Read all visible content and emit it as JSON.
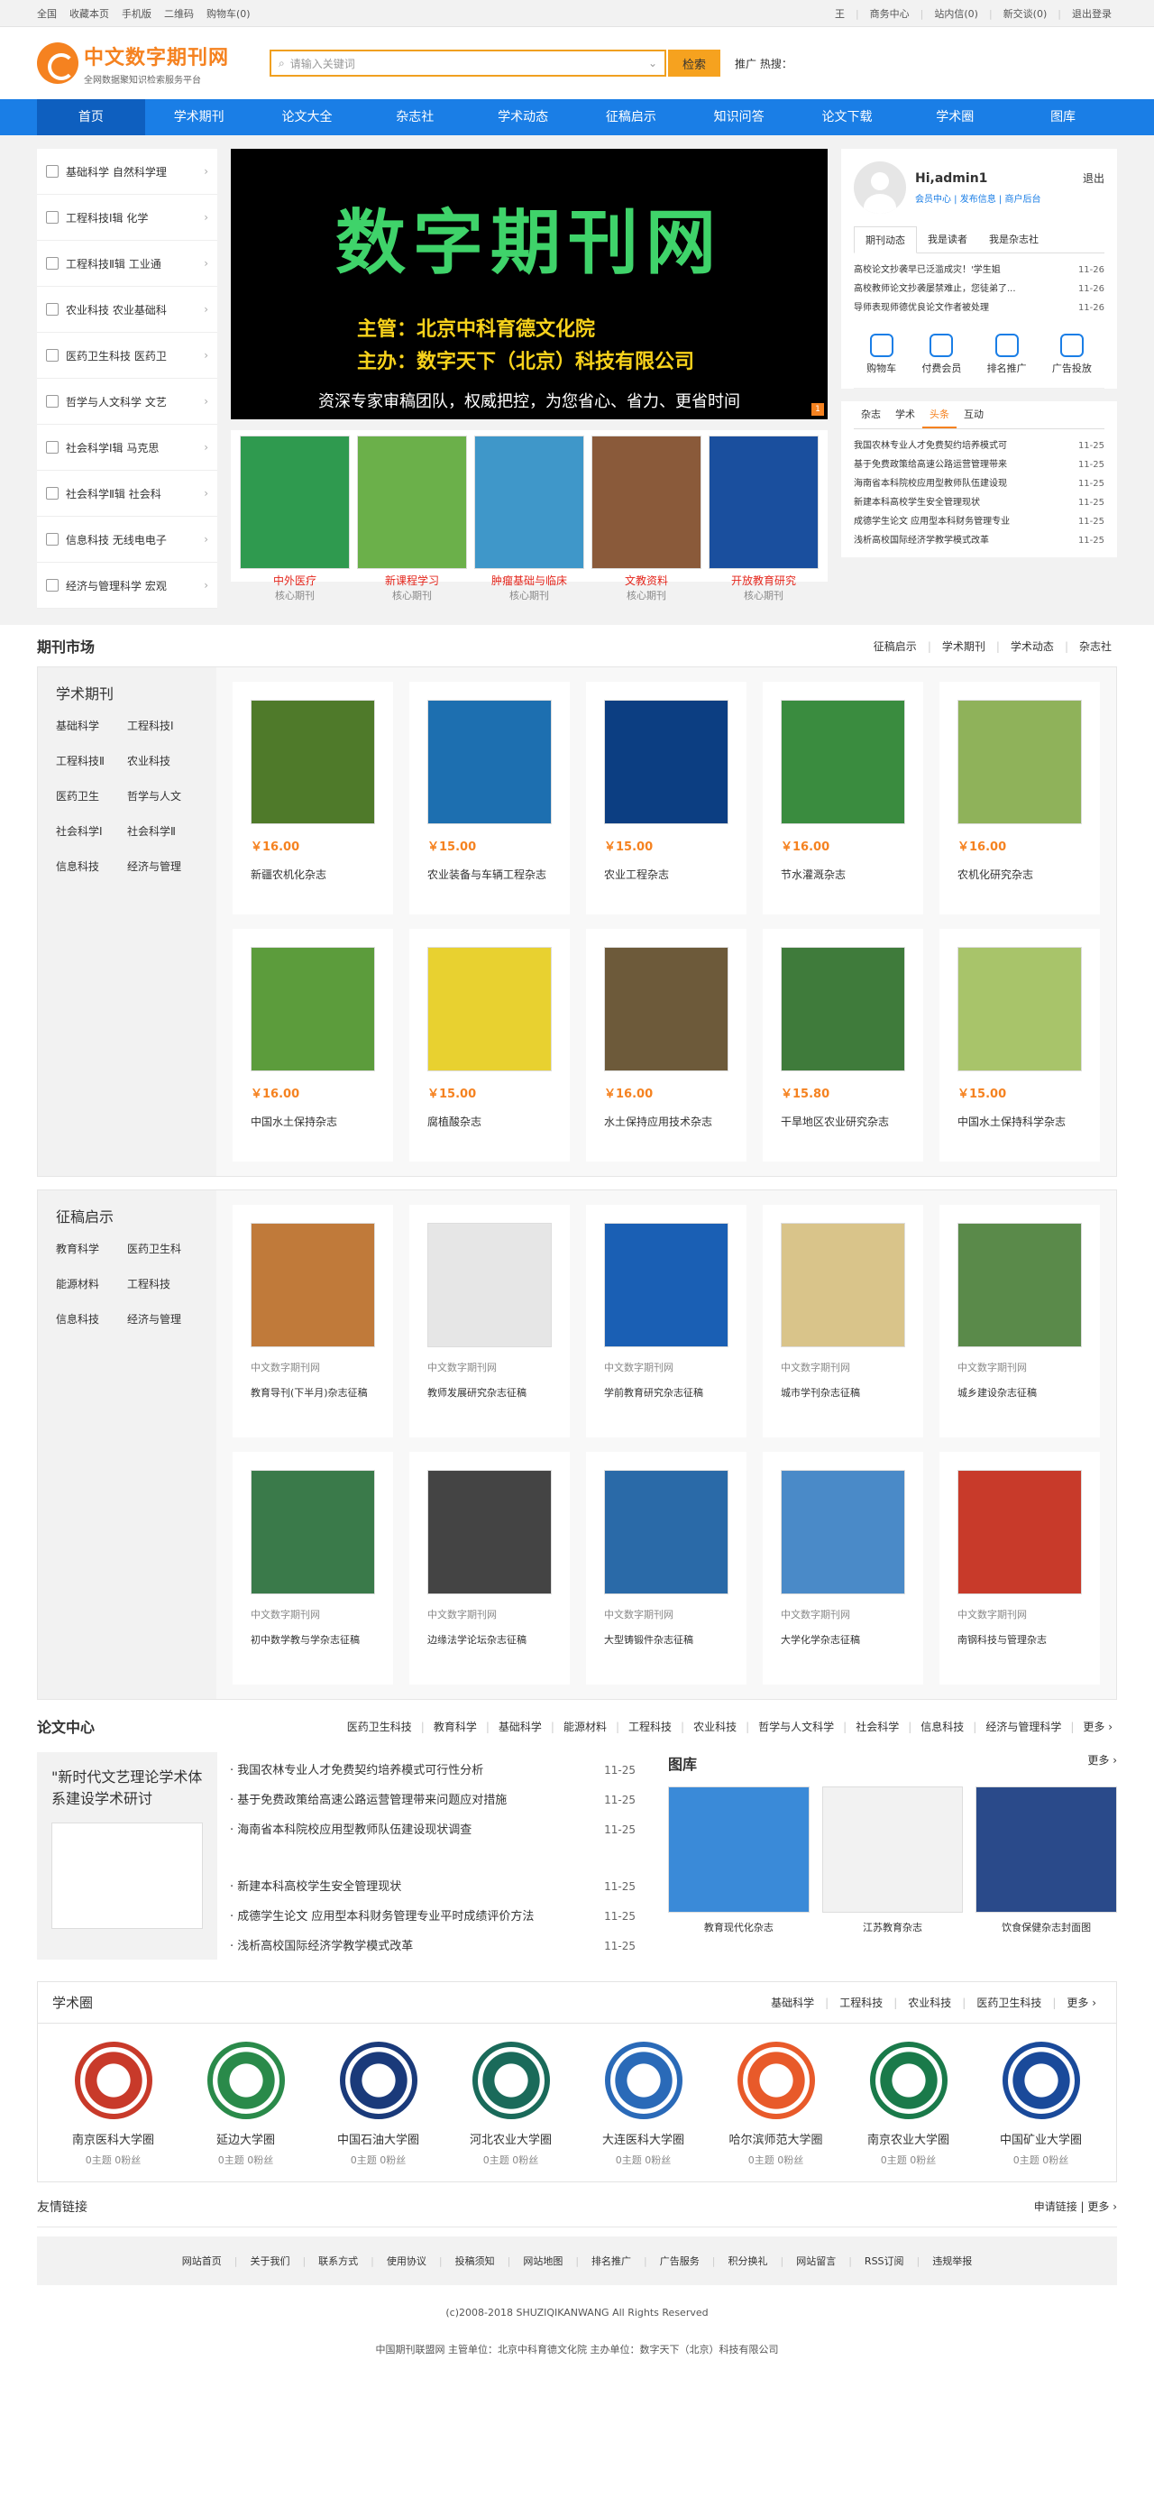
{
  "topbar": {
    "left": [
      "全国",
      "收藏本页",
      "手机版",
      "二维码",
      "购物车(0)"
    ],
    "right": [
      "王",
      "商务中心",
      "站内信(0)",
      "新交谈(0)",
      "退出登录"
    ]
  },
  "logo": {
    "title": "中文数字期刊网",
    "subtitle": "全网数据聚知识检索服务平台"
  },
  "search": {
    "placeholder": "请输入关键词",
    "button": "检索",
    "hot": "推广 热搜："
  },
  "nav": [
    "首页",
    "学术期刊",
    "论文大全",
    "杂志社",
    "学术动态",
    "征稿启示",
    "知识问答",
    "论文下载",
    "学术圈",
    "图库"
  ],
  "categories": [
    "基础科学 自然科学理",
    "工程科技Ⅰ辑 化学",
    "工程科技Ⅱ辑 工业通",
    "农业科技 农业基础科",
    "医药卫生科技 医药卫",
    "哲学与人文科学 文艺",
    "社会科学Ⅰ辑 马克思",
    "社会科学Ⅱ辑 社会科",
    "信息科技 无线电电子",
    "经济与管理科学 宏观"
  ],
  "slide": {
    "title": "数字期刊网",
    "line1": "主管：北京中科育德文化院",
    "line2": "主办：数字天下（北京）科技有限公司",
    "line3": "资深专家审稿团队，权威把控，为您省心、省力、更省时间",
    "page": "1"
  },
  "mags": [
    {
      "name": "中外医疗",
      "sub": "核心期刊",
      "color": "#2f9a4f"
    },
    {
      "name": "新课程学习",
      "sub": "核心期刊",
      "color": "#6bb04a"
    },
    {
      "name": "肿瘤基础与临床",
      "sub": "核心期刊",
      "color": "#3f97c9"
    },
    {
      "name": "文教资料",
      "sub": "核心期刊",
      "color": "#8a5a3a"
    },
    {
      "name": "开放教育研究",
      "sub": "核心期刊",
      "color": "#1a4f9e"
    }
  ],
  "user": {
    "name": "Hi,admin1",
    "links": "会员中心 | 发布信息 | 商户后台",
    "logout": "退出"
  },
  "userTabs": [
    "期刊动态",
    "我是读者",
    "我是杂志社"
  ],
  "userNews": [
    {
      "t": "高校论文抄袭早已泛滥成灾！'学生姐",
      "d": "11-26"
    },
    {
      "t": "高校教师论文抄袭屡禁难止，您徒弟了...",
      "d": "11-26"
    },
    {
      "t": "导师表现师德优良论文作者被处理",
      "d": "11-26"
    }
  ],
  "icons": [
    "购物车",
    "付费会员",
    "排名推广",
    "广告投放"
  ],
  "news2Tabs": [
    "杂志",
    "学术",
    "头条",
    "互动"
  ],
  "news2": [
    {
      "t": "我国农林专业人才免费契约培养模式可",
      "d": "11-25"
    },
    {
      "t": "基于免费政策给高速公路运营管理带来",
      "d": "11-25"
    },
    {
      "t": "海南省本科院校应用型教师队伍建设现",
      "d": "11-25"
    },
    {
      "t": "新建本科高校学生安全管理现状",
      "d": "11-25"
    },
    {
      "t": "成德学生论文 应用型本科财务管理专业",
      "d": "11-25"
    },
    {
      "t": "浅析高校国际经济学教学模式改革",
      "d": "11-25"
    }
  ],
  "market": {
    "title": "期刊市场",
    "links": [
      "征稿启示",
      "学术期刊",
      "学术动态",
      "杂志社"
    ]
  },
  "xsqk": {
    "title": "学术期刊",
    "items": [
      "基础科学",
      "工程科技Ⅰ",
      "工程科技Ⅱ",
      "农业科技",
      "医药卫生",
      "哲学与人文",
      "社会科学Ⅰ",
      "社会科学Ⅱ",
      "信息科技",
      "经济与管理"
    ]
  },
  "xsqkCards": [
    {
      "p": "￥16.00",
      "n": "新疆农机化杂志",
      "c": "#4f7a2a"
    },
    {
      "p": "￥15.00",
      "n": "农业装备与车辆工程杂志",
      "c": "#1d6fb0"
    },
    {
      "p": "￥15.00",
      "n": "农业工程杂志",
      "c": "#0c3e82"
    },
    {
      "p": "￥16.00",
      "n": "节水灌溉杂志",
      "c": "#3a8c3f"
    },
    {
      "p": "￥16.00",
      "n": "农机化研究杂志",
      "c": "#8fb25a"
    },
    {
      "p": "￥16.00",
      "n": "中国水土保持杂志",
      "c": "#5c9c3c"
    },
    {
      "p": "￥15.00",
      "n": "腐植酸杂志",
      "c": "#e8d130"
    },
    {
      "p": "￥16.00",
      "n": "水土保持应用技术杂志",
      "c": "#6d5a3a"
    },
    {
      "p": "￥15.80",
      "n": "干旱地区农业研究杂志",
      "c": "#3f7b3b"
    },
    {
      "p": "￥15.00",
      "n": "中国水土保持科学杂志",
      "c": "#a8c46a"
    }
  ],
  "zgqs": {
    "title": "征稿启示",
    "items": [
      "教育科学",
      "医药卫生科",
      "能源材料",
      "工程科技",
      "信息科技",
      "经济与管理"
    ]
  },
  "zgqsCards": [
    {
      "s": "中文数字期刊网",
      "n": "教育导刊(下半月)杂志征稿",
      "c": "#c07a3a"
    },
    {
      "s": "中文数字期刊网",
      "n": "教师发展研究杂志征稿",
      "c": "#e6e6e6"
    },
    {
      "s": "中文数字期刊网",
      "n": "学前教育研究杂志征稿",
      "c": "#1a5fb4"
    },
    {
      "s": "中文数字期刊网",
      "n": "城市学刊杂志征稿",
      "c": "#d9c48a"
    },
    {
      "s": "中文数字期刊网",
      "n": "城乡建设杂志征稿",
      "c": "#5a8a4a"
    },
    {
      "s": "中文数字期刊网",
      "n": "初中数学教与学杂志征稿",
      "c": "#3a7a4a"
    },
    {
      "s": "中文数字期刊网",
      "n": "边缘法学论坛杂志征稿",
      "c": "#444444"
    },
    {
      "s": "中文数字期刊网",
      "n": "大型铸锻件杂志征稿",
      "c": "#2a6aa8"
    },
    {
      "s": "中文数字期刊网",
      "n": "大学化学杂志征稿",
      "c": "#4a8ac8"
    },
    {
      "s": "中文数字期刊网",
      "n": "南钢科技与管理杂志",
      "c": "#c83a2a"
    }
  ],
  "lwzx": {
    "title": "论文中心",
    "links": [
      "医药卫生科技",
      "教育科学",
      "基础科学",
      "能源材料",
      "工程科技",
      "农业科技",
      "哲学与人文科学",
      "社会科学",
      "信息科技",
      "经济与管理科学",
      "更多 ›"
    ],
    "feature": "\"新时代文艺理论学术体系建设学术研讨",
    "news": [
      {
        "t": "· 我国农林专业人才免费契约培养模式可行性分析",
        "d": "11-25"
      },
      {
        "t": "· 基于免费政策给高速公路运营管理带来问题应对措施",
        "d": "11-25"
      },
      {
        "t": "· 海南省本科院校应用型教师队伍建设现状调查",
        "d": "11-25"
      },
      {
        "t": "· 新建本科高校学生安全管理现状",
        "d": "11-25"
      },
      {
        "t": "· 成德学生论文 应用型本科财务管理专业平时成绩评价方法",
        "d": "11-25"
      },
      {
        "t": "· 浅析高校国际经济学教学模式改革",
        "d": "11-25"
      }
    ]
  },
  "tuku": {
    "title": "图库",
    "more": "更多 ›",
    "items": [
      {
        "n": "教育现代化杂志",
        "c": "#3a8ad8"
      },
      {
        "n": "江苏教育杂志",
        "c": "#f2f2f2"
      },
      {
        "n": "饮食保健杂志封面图",
        "c": "#2a4a8a"
      }
    ]
  },
  "xsq": {
    "title": "学术圈",
    "links": [
      "基础科学",
      "工程科技",
      "农业科技",
      "医药卫生科技",
      "更多 ›"
    ],
    "unis": [
      {
        "n": "南京医科大学圈",
        "s": "0主题 0粉丝",
        "c": "#c83a2a"
      },
      {
        "n": "延边大学圈",
        "s": "0主题 0粉丝",
        "c": "#2a8a4a"
      },
      {
        "n": "中国石油大学圈",
        "s": "0主题 0粉丝",
        "c": "#1a3a7a"
      },
      {
        "n": "河北农业大学圈",
        "s": "0主题 0粉丝",
        "c": "#1a6a5a"
      },
      {
        "n": "大连医科大学圈",
        "s": "0主题 0粉丝",
        "c": "#2a6ab8"
      },
      {
        "n": "哈尔滨师范大学圈",
        "s": "0主题 0粉丝",
        "c": "#e85a2a"
      },
      {
        "n": "南京农业大学圈",
        "s": "0主题 0粉丝",
        "c": "#1a7a4a"
      },
      {
        "n": "中国矿业大学圈",
        "s": "0主题 0粉丝",
        "c": "#1a4a9a"
      }
    ]
  },
  "links": {
    "title": "友情链接",
    "right": "申请链接 | 更多 ›"
  },
  "footer": {
    "links": [
      "网站首页",
      "关于我们",
      "联系方式",
      "使用协议",
      "投稿须知",
      "网站地图",
      "排名推广",
      "广告服务",
      "积分换礼",
      "网站留言",
      "RSS订阅",
      "违规举报"
    ],
    "copy": "(c)2008-2018 SHUZIQIKANWANG All Rights Reserved",
    "org": "中国期刊联盟网 主管单位：北京中科育德文化院 主办单位：数字天下（北京）科技有限公司"
  }
}
